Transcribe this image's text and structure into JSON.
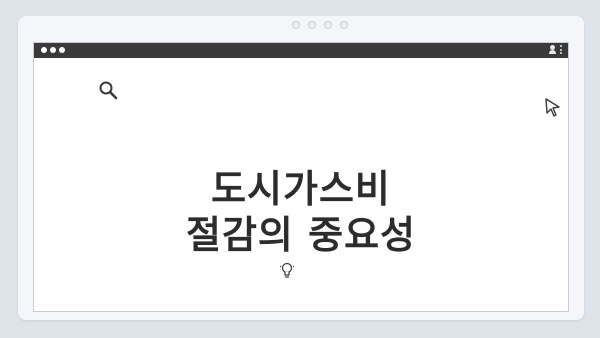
{
  "heading": {
    "line1": "도시가스비",
    "line2": "절감의 중요성"
  },
  "icons": {
    "top_dots": "carousel-dots",
    "window_controls": "three-dot-window-controls",
    "search": "search-icon",
    "cursor": "cursor-icon",
    "user": "user-icon",
    "menu": "kebab-menu-icon",
    "bulb": "lightbulb-icon"
  },
  "colors": {
    "page_background": "#dfe4ea",
    "card_background": "#f4f6f9",
    "title_bar": "#3a3a3a",
    "window_background": "#ffffff",
    "text": "#2c2c2c"
  }
}
